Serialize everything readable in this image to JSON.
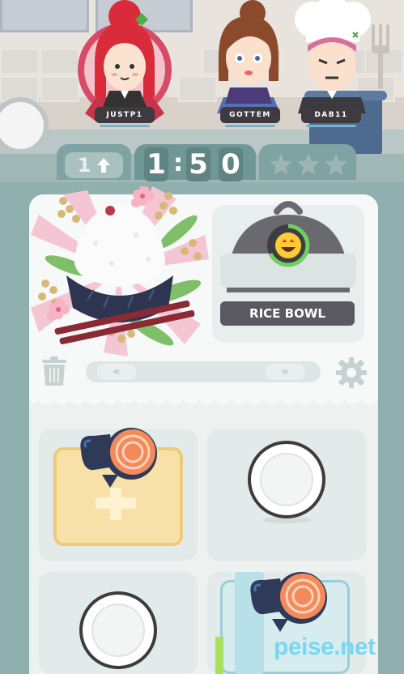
{
  "players": [
    {
      "name": "JUSTP1",
      "role": "host"
    },
    {
      "name": "GOTTEM"
    },
    {
      "name": "DAB11"
    }
  ],
  "hud": {
    "level": "1",
    "timer_digits": [
      "1",
      "5",
      "0"
    ],
    "timer_sep": ":",
    "stars_earned": 0,
    "stars_total": 3
  },
  "order": {
    "title": "RICE BOWL",
    "mood": "happy",
    "ingredient_slots": [
      "empty-plate",
      "rice",
      "rice"
    ]
  },
  "controls": {
    "scroll_left": "«",
    "scroll_right": "»"
  },
  "stations": [
    {
      "type": "cutting-board",
      "item": "salmon"
    },
    {
      "type": "plate",
      "item": "empty"
    },
    {
      "type": "plate",
      "item": "empty"
    },
    {
      "type": "fridge",
      "item": "salmon"
    }
  ],
  "watermark": "peise.net",
  "colors": {
    "board": "#8fb0ae",
    "panel": "#edf2f1",
    "timer": "#5f8483",
    "title_bar": "#5a5961"
  }
}
